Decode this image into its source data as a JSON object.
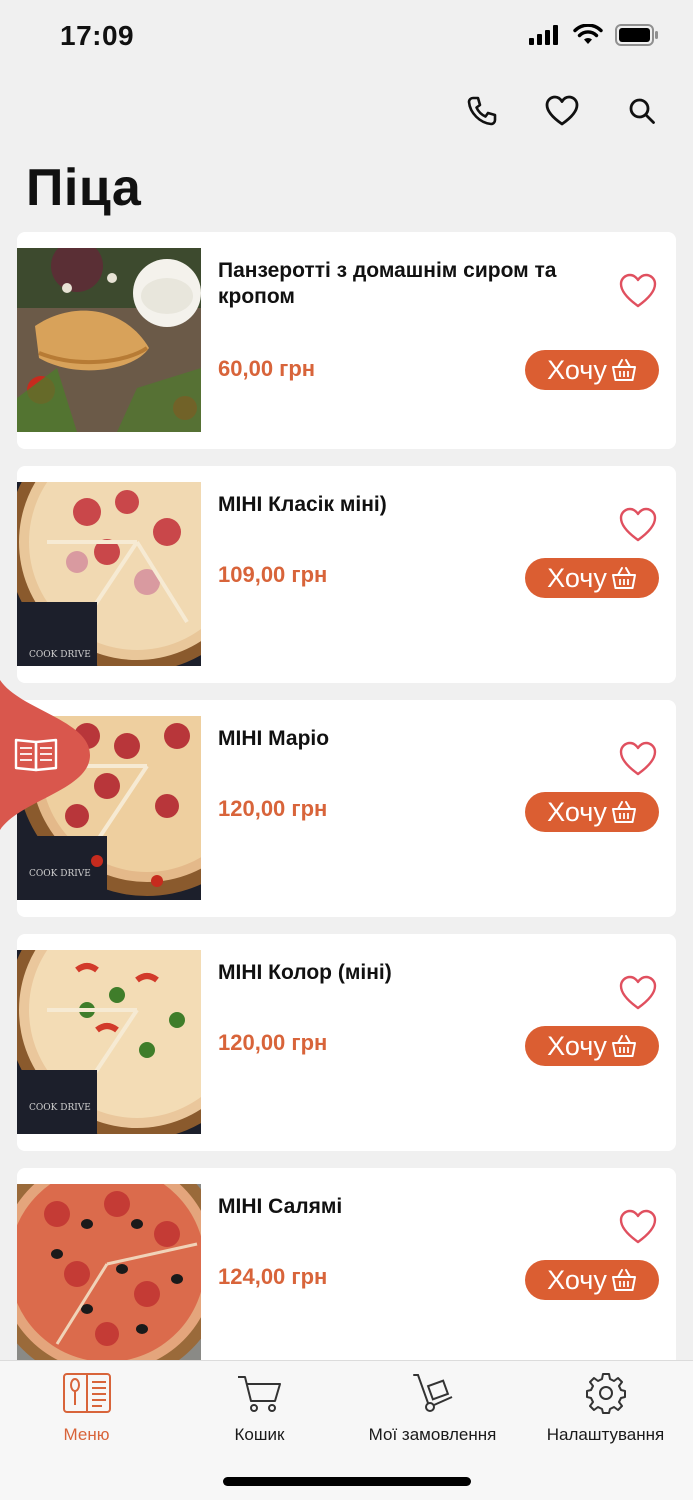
{
  "status": {
    "time": "17:09"
  },
  "header": {
    "title": "Піца"
  },
  "colors": {
    "accent": "#db5e32",
    "price": "#d8643a",
    "heart": "#e0505f",
    "background": "#f0f0f0"
  },
  "icons": [
    "phone-icon",
    "heart-icon",
    "search-icon",
    "basket-icon",
    "book-icon",
    "menu-book-icon",
    "cart-icon",
    "hand-truck-icon",
    "gear-icon"
  ],
  "products": [
    {
      "name": "Панзеротті з домашнім сиром та кропом",
      "price": "60,00 грн",
      "button": "Хочу"
    },
    {
      "name": "МІНІ Класік міні)",
      "price": "109,00 грн",
      "button": "Хочу"
    },
    {
      "name": "МІНІ Маріо",
      "price": "120,00 грн",
      "button": "Хочу"
    },
    {
      "name": "МІНІ Колор (міні)",
      "price": "120,00 грн",
      "button": "Хочу"
    },
    {
      "name": "МІНІ Салямі",
      "price": "124,00 грн",
      "button": "Хочу"
    }
  ],
  "tabs": [
    {
      "label": "Меню",
      "active": true
    },
    {
      "label": "Кошик",
      "active": false
    },
    {
      "label": "Мої замовлення",
      "active": false
    },
    {
      "label": "Налаштування",
      "active": false
    }
  ]
}
